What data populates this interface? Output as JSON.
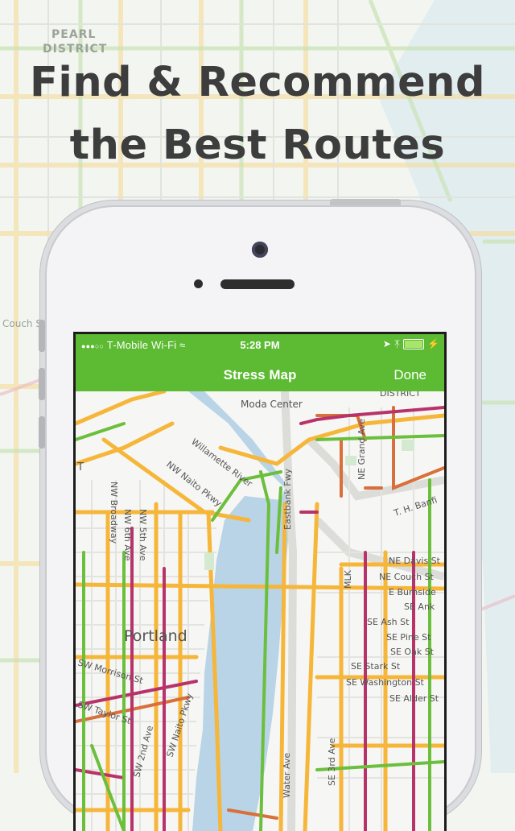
{
  "headline": {
    "line1": "Find & Recommend",
    "line2": "the Best Routes"
  },
  "background_labels": {
    "pearl": "PEARL",
    "district": "DISTRICT",
    "couch": "Couch S"
  },
  "status_bar": {
    "signal": "●●●○○",
    "carrier": "T-Mobile Wi-Fi",
    "time": "5:28 PM"
  },
  "nav": {
    "title": "Stress Map",
    "done": "Done"
  },
  "map": {
    "city": "Portland",
    "labels": {
      "moda_center": "Moda Center",
      "district": "DISTRICT",
      "willamette_river": "Willamette River",
      "nw_naito_pkwy": "NW Naito Pkwy",
      "nw_broadway": "NW Broadway",
      "nw_5th_ave": "NW 5th Ave",
      "nw_6th_ave": "NW 6th Ave",
      "eastbank_fwy": "Eastbank Fwy",
      "ne_grand_ave": "NE Grand Ave",
      "th_banfield": "T. H. Banfi",
      "ne_davis": "NE Davis St",
      "ne_couch": "NE Couch St",
      "e_burnside": "E Burnside",
      "se_ank": "SE Ank",
      "mlk": "MLK",
      "se_ash": "SE Ash St",
      "se_pine": "SE Pine St",
      "se_oak": "SE Oak St",
      "se_stark": "SE Stark St",
      "se_washington": "SE Washington St",
      "se_alder": "SE Alder St",
      "sw_morrison": "SW Morrison St",
      "sw_taylor": "SW Taylor St",
      "sw_2nd": "SW 2nd Ave",
      "sw_naito": "SW Naito Pkwy",
      "water_ave": "Water Ave",
      "se_3rd": "SE 3rd Ave",
      "t_letter": "T"
    }
  },
  "colors": {
    "nav_green": "#5cba33",
    "low_stress": "#6bbf3c",
    "medium_stress": "#f5b63a",
    "high_stress": "#d96f3a",
    "very_high_stress": "#b8336a",
    "river": "#b8d4e6"
  }
}
